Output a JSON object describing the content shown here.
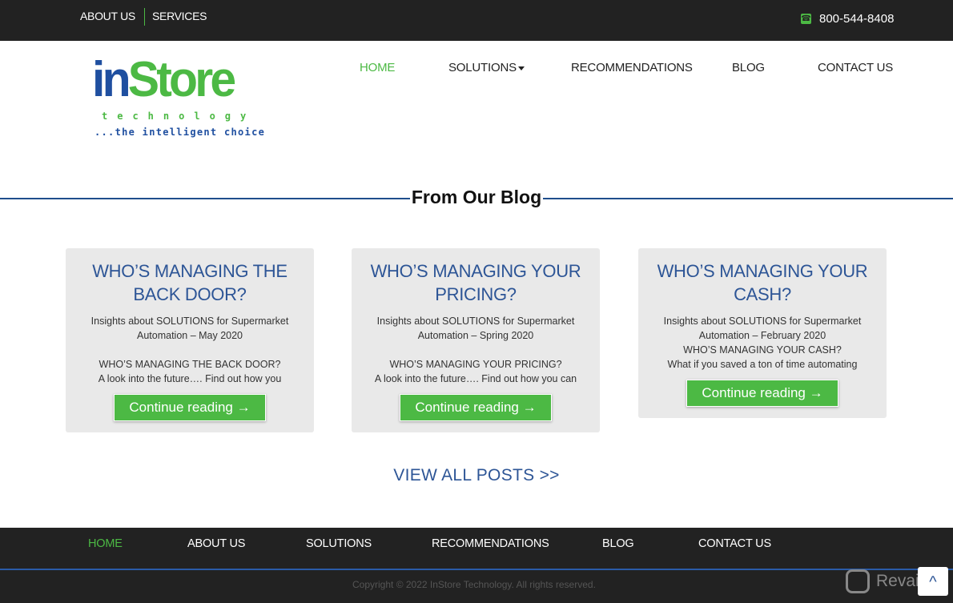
{
  "topbar": {
    "links": [
      "ABOUT US",
      "SERVICES"
    ],
    "phone": "800-544-8408",
    "phone_icon": "phone-icon"
  },
  "logo": {
    "main_in": "in",
    "main_store": "Store",
    "sub": "technology",
    "tagline": "...the intelligent choice"
  },
  "nav": {
    "items": [
      "HOME",
      "SOLUTIONS",
      "RECOMMENDATIONS",
      "BLOG",
      "CONTACT US"
    ],
    "active": "HOME"
  },
  "blog": {
    "title": "From Our Blog",
    "posts": [
      {
        "title": "WHO’S MANAGING THE BACK DOOR?",
        "meta1": "Insights about SOLUTIONS for Supermarket",
        "meta2": "Automation – May 2020",
        "ex1": "WHO’S MANAGING THE BACK DOOR?",
        "ex2": "A look into the future…. Find out how you",
        "button": "Continue reading →"
      },
      {
        "title": "WHO’S MANAGING YOUR PRICING?",
        "meta1": "Insights about SOLUTIONS for Supermarket",
        "meta2": "Automation – Spring 2020",
        "ex1": "WHO’S MANAGING YOUR PRICING?",
        "ex2": "A look into the future…. Find out how you can",
        "button": "Continue reading →"
      },
      {
        "title": "WHO’S MANAGING YOUR CASH?",
        "meta1": "Insights about SOLUTIONS for Supermarket",
        "meta2": "Automation – February 2020",
        "ex1": "WHO’S MANAGING YOUR CASH?",
        "ex2": "What if you saved a ton of time automating",
        "button": "Continue reading →"
      }
    ],
    "view_all": "VIEW ALL POSTS >>"
  },
  "footer": {
    "nav": [
      "HOME",
      "ABOUT US",
      "SOLUTIONS",
      "RECOMMENDATIONS",
      "BLOG",
      "CONTACT US"
    ],
    "copyright": "Copyright © 2022 InStore Technology. All rights reserved.",
    "watermark": "Revain",
    "to_top": "^"
  },
  "colors": {
    "green": "#4cb944",
    "blue": "#2d5596",
    "dark": "#222222"
  }
}
